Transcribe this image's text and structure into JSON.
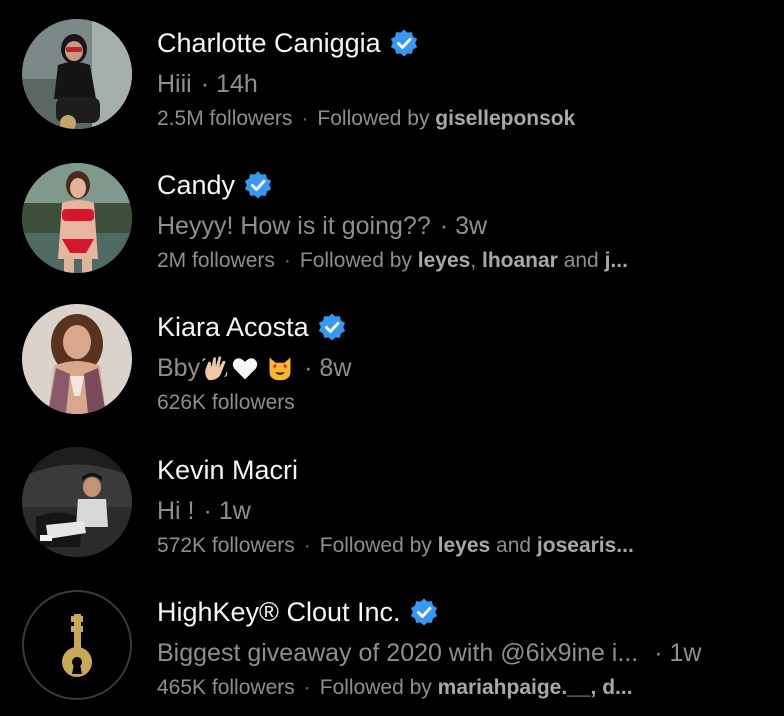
{
  "colors": {
    "background": "#000000",
    "primary_text": "#f5f5f5",
    "secondary_text": "#8e8e8e",
    "verified_blue": "#3897f0",
    "key_gold": "#c9a85a"
  },
  "rows": [
    {
      "name": "Charlotte Caniggia",
      "verified": true,
      "message": "Hiii",
      "time": "14h",
      "followers": "2.5M followers",
      "followed_by_prefix": "Followed by ",
      "followed_by_users": "giselleponsok",
      "followed_by_suffix": ""
    },
    {
      "name": "Candy",
      "verified": true,
      "message": "Heyyy! How is it going??",
      "time": "3w",
      "followers": "2M followers",
      "followed_by_prefix": "Followed by ",
      "followed_by_user1": "leyes",
      "followed_by_comma": ", ",
      "followed_by_user2": "lhoanar",
      "followed_by_and": " and ",
      "followed_by_user3": "j..."
    },
    {
      "name": "Kiara Acosta",
      "verified": true,
      "message": "Bby",
      "emojis": [
        "waving-hand-emoji",
        "white-heart-emoji",
        "heart-eyes-cat-emoji"
      ],
      "time": "8w",
      "followers": "626K followers"
    },
    {
      "name": "Kevin Macri",
      "verified": false,
      "message": "Hi !",
      "time": "1w",
      "followers": "572K followers",
      "followed_by_prefix": "Followed by ",
      "followed_by_user1": "leyes",
      "followed_by_and": " and ",
      "followed_by_user2": "josearis..."
    },
    {
      "name": "HighKey® Clout Inc.",
      "verified": true,
      "message": "Biggest giveaway of 2020 with @6ix9ine i...",
      "time": "1w",
      "followers": "465K followers",
      "followed_by_prefix": "Followed by ",
      "followed_by_users": "mariahpaige.__, d..."
    }
  ],
  "separator": "·"
}
